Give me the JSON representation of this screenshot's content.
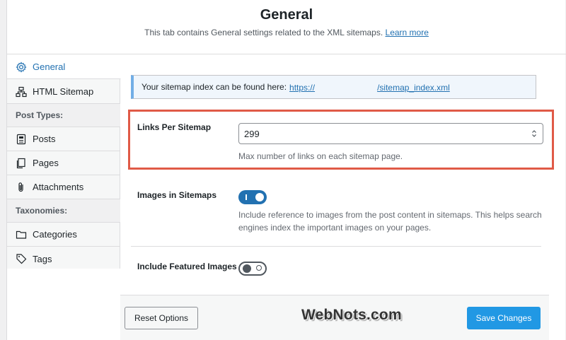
{
  "header": {
    "title": "General",
    "description": "This tab contains General settings related to the XML sitemaps.",
    "learn_more": "Learn more"
  },
  "sidebar": {
    "general": "General",
    "html_sitemap": "HTML Sitemap",
    "post_types_heading": "Post Types:",
    "posts": "Posts",
    "pages": "Pages",
    "attachments": "Attachments",
    "taxonomies_heading": "Taxonomies:",
    "categories": "Categories",
    "tags": "Tags"
  },
  "notice": {
    "text": "Your sitemap index can be found here:",
    "link_prefix": "https://",
    "link_suffix": "/sitemap_index.xml"
  },
  "links_per_sitemap": {
    "label": "Links Per Sitemap",
    "value": "299",
    "help": "Max number of links on each sitemap page."
  },
  "images_in_sitemaps": {
    "label": "Images in Sitemaps",
    "enabled": true,
    "help_line1": "Include reference to images from the post content in sitemaps. This helps search",
    "help_line2": "engines index the important images on your pages."
  },
  "include_featured_images": {
    "label": "Include Featured Images",
    "enabled": false
  },
  "footer": {
    "reset": "Reset Options",
    "save": "Save Changes",
    "watermark": "WebNots.com"
  },
  "colors": {
    "accent": "#2271b1",
    "save_button": "#2198e4",
    "highlight": "#e05a47"
  }
}
